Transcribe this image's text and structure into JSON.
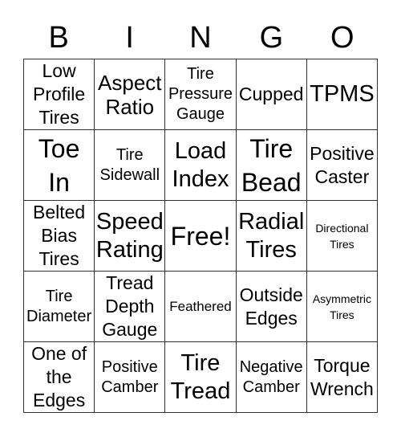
{
  "header": {
    "letters": [
      "B",
      "I",
      "N",
      "G",
      "O"
    ]
  },
  "rows": [
    [
      "Low Profile Tires",
      "Aspect Ratio",
      "Tire Pressure Gauge",
      "Cupped",
      "TPMS"
    ],
    [
      "Toe In",
      "Tire Sidewall",
      "Load Index",
      "Tire Bead",
      "Positive Caster"
    ],
    [
      "Belted Bias Tires",
      "Speed Rating",
      "Free!",
      "Radial Tires",
      "Directional Tires"
    ],
    [
      "Tire Diameter",
      "Tread Depth Gauge",
      "Feathered",
      "Outside Edges",
      "Asymmetric Tires"
    ],
    [
      "One of the Edges",
      "Positive Camber",
      "Tire Tread",
      "Negative Camber",
      "Torque Wrench"
    ]
  ]
}
